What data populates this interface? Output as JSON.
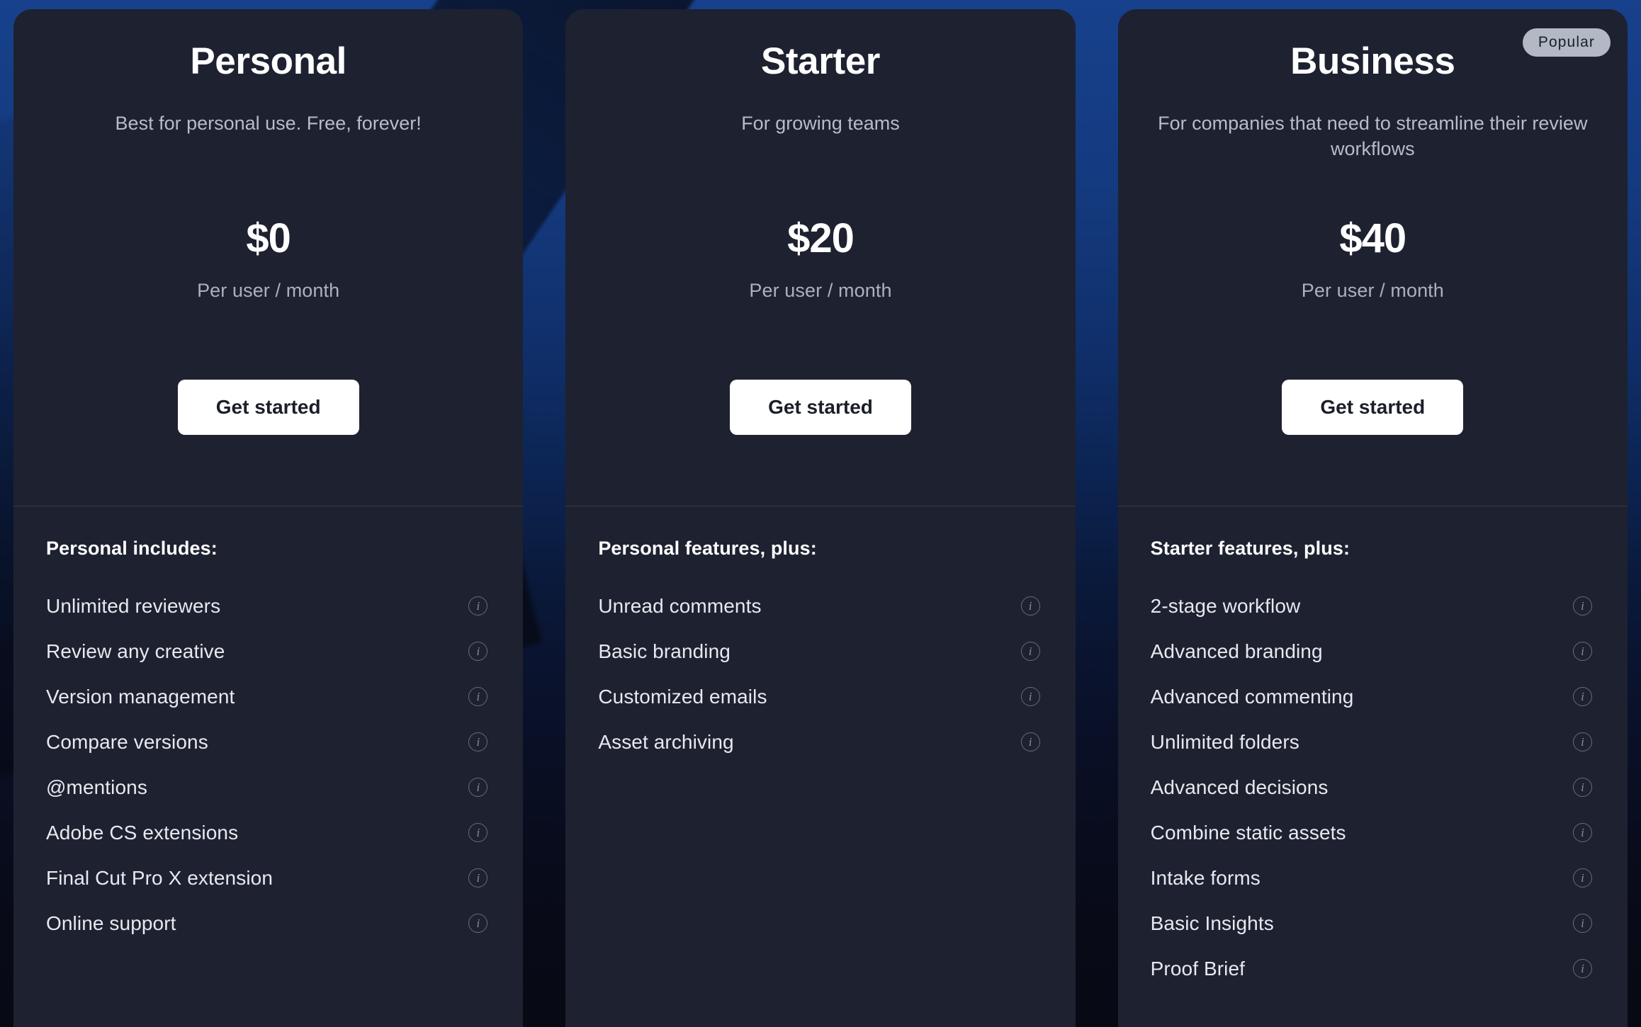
{
  "theme": {
    "card_bg": "#1e2130",
    "accent_blue": "#17418c",
    "cta_bg": "#ffffff",
    "cta_text": "#1b1f2b",
    "badge_bg": "#b2b9c4",
    "muted_text": "#b6bcca",
    "feature_text": "#e7e9f0",
    "divider": "#343848"
  },
  "price_suffix": "Per user / month",
  "cta_label": "Get started",
  "info_icon_glyph": "i",
  "plans": [
    {
      "name": "Personal",
      "description": "Best for personal use. Free, forever!",
      "price": "$0",
      "price_sub": "Per user / month",
      "cta": "Get started",
      "badge": null,
      "features_title": "Personal includes:",
      "features": [
        "Unlimited reviewers",
        "Review any creative",
        "Version management",
        "Compare versions",
        "@mentions",
        "Adobe CS extensions",
        "Final Cut Pro X extension",
        "Online support"
      ]
    },
    {
      "name": "Starter",
      "description": "For growing teams",
      "price": "$20",
      "price_sub": "Per user / month",
      "cta": "Get started",
      "badge": null,
      "features_title": "Personal features, plus:",
      "features": [
        "Unread comments",
        "Basic branding",
        "Customized emails",
        "Asset archiving"
      ]
    },
    {
      "name": "Business",
      "description": "For companies that need to streamline their review workflows",
      "price": "$40",
      "price_sub": "Per user / month",
      "cta": "Get started",
      "badge": "Popular",
      "features_title": "Starter features, plus:",
      "features": [
        "2-stage workflow",
        "Advanced branding",
        "Advanced commenting",
        "Unlimited folders",
        "Advanced decisions",
        "Combine static assets",
        "Intake forms",
        "Basic Insights",
        "Proof Brief"
      ]
    }
  ]
}
